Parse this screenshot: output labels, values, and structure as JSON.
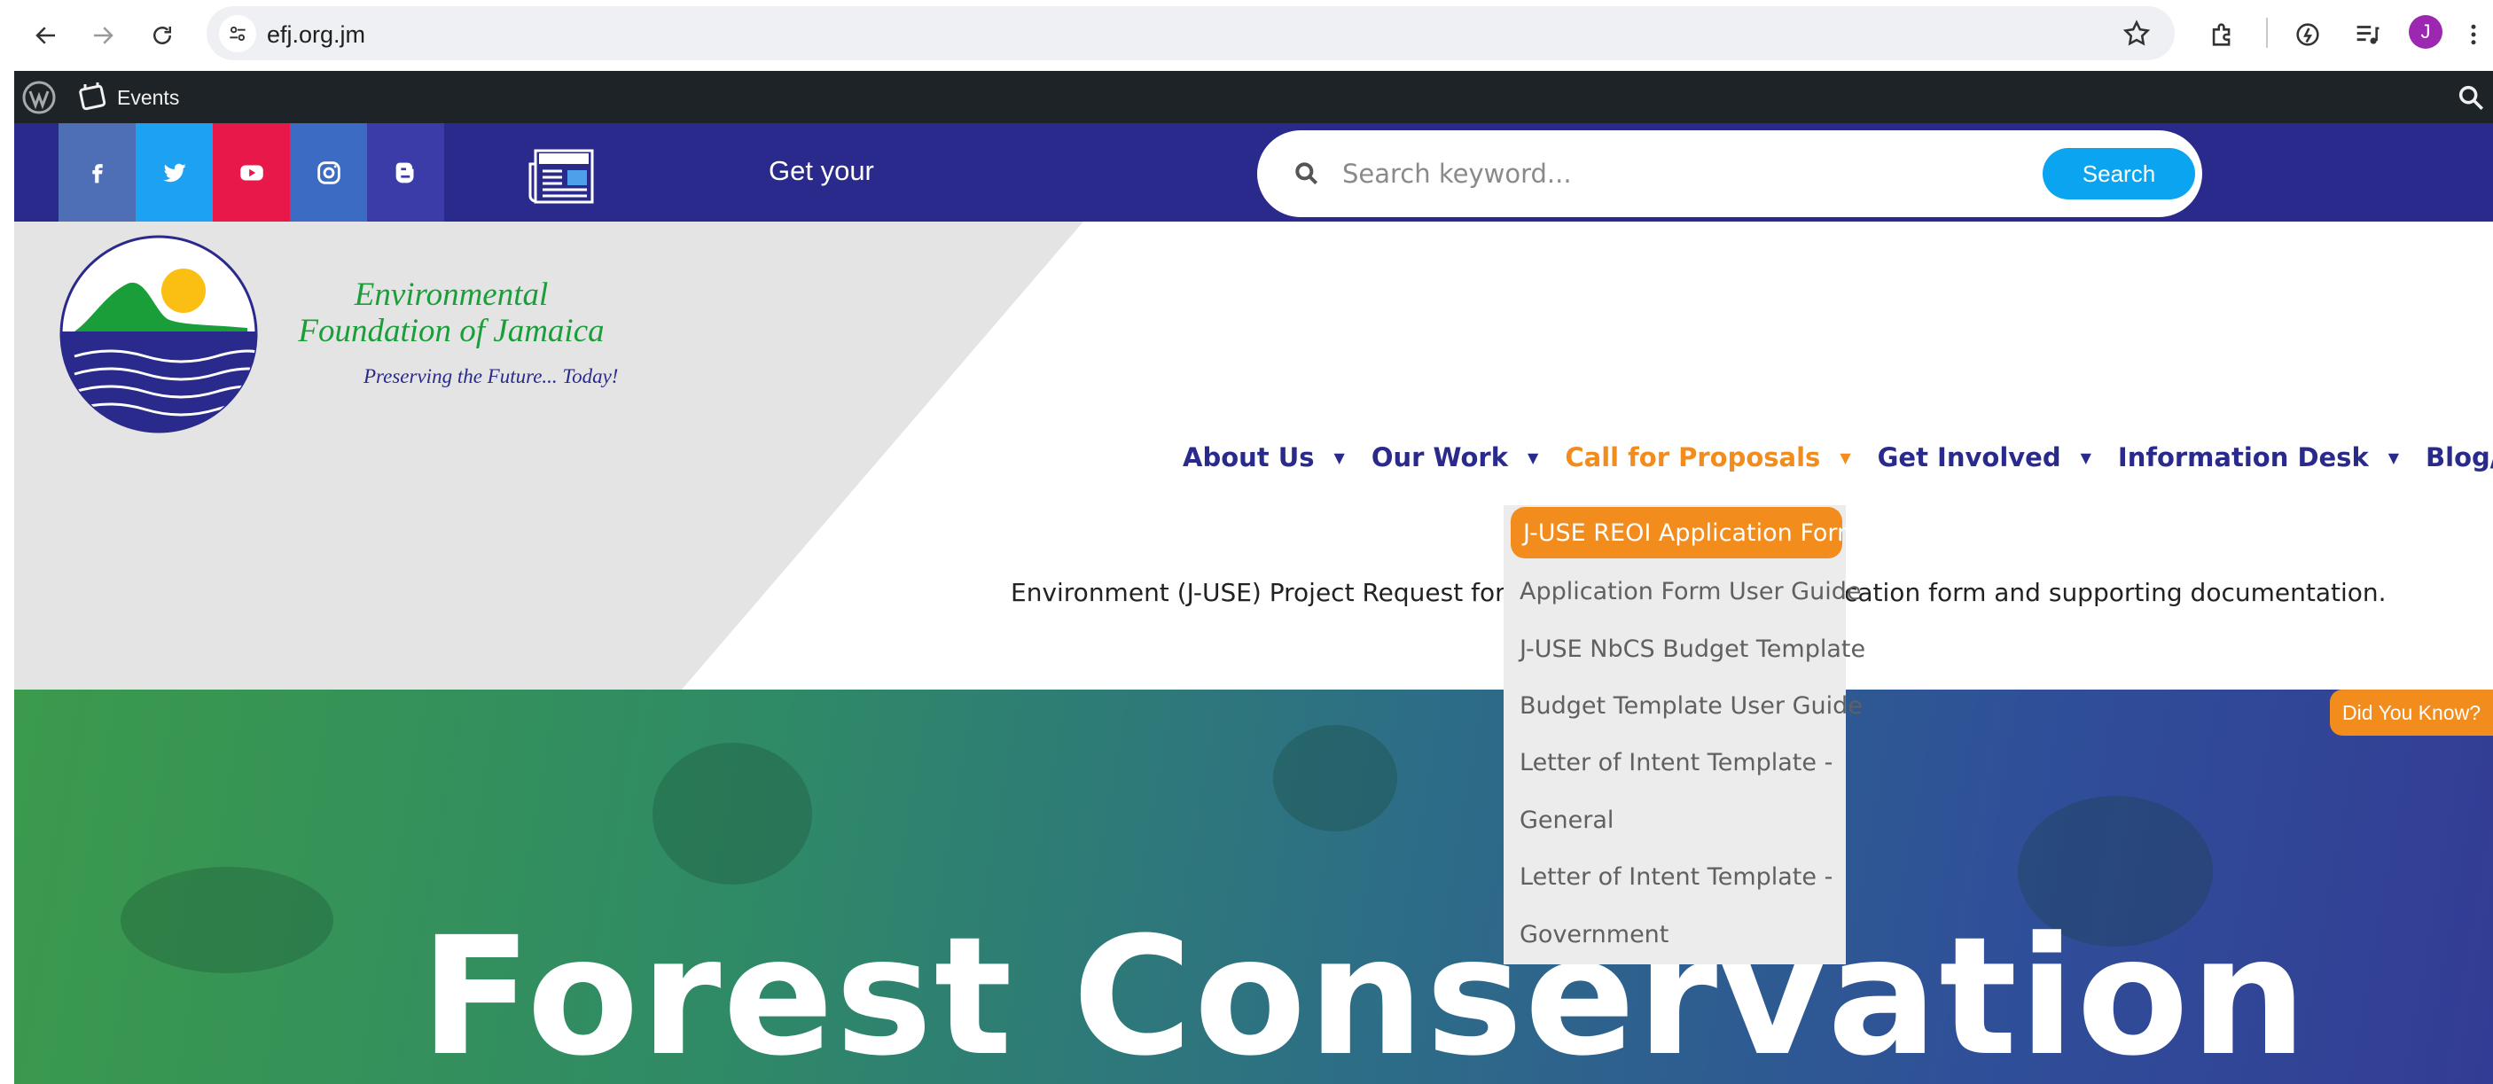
{
  "browser": {
    "url": "efj.org.jm",
    "avatar_letter": "J"
  },
  "admin_bar": {
    "events_label": "Events"
  },
  "top_bar": {
    "social_colors": [
      "#4e6fb5",
      "#1da1f2",
      "#e8184a",
      "#3c6bc4",
      "#3c3ca8"
    ],
    "get_your_text": "Get your",
    "search_placeholder": "Search keyword...",
    "search_button": "Search"
  },
  "logo": {
    "title": "Environmental Foundation of Jamaica",
    "tagline": "Preserving the Future... Today!"
  },
  "nav": {
    "items": [
      {
        "label": "About Us"
      },
      {
        "label": "Our Work"
      },
      {
        "label": "Call for Proposals"
      },
      {
        "label": "Get Involved"
      },
      {
        "label": "Information Desk"
      },
      {
        "label": "Blog/Podcast"
      }
    ],
    "caret": "▼"
  },
  "description": {
    "left": "Environment (J-USE) Project Request for E",
    "right": "cation form and supporting documentation."
  },
  "dropdown": {
    "items": [
      "J-USE REOI Application Form",
      "Application Form User Guide",
      "J-USE NbCS Budget Template",
      "Budget Template User Guide",
      "Letter of Intent Template -",
      "General",
      "Letter of Intent Template -",
      "Government"
    ]
  },
  "hero": {
    "title": "Forest Conservation",
    "did_you_know": "Did You Know?"
  },
  "colors": {
    "brand_blue": "#2a2a8c",
    "accent_orange": "#f28c1c",
    "logo_green": "#1a9e3a",
    "search_blue": "#0aa4f0"
  }
}
